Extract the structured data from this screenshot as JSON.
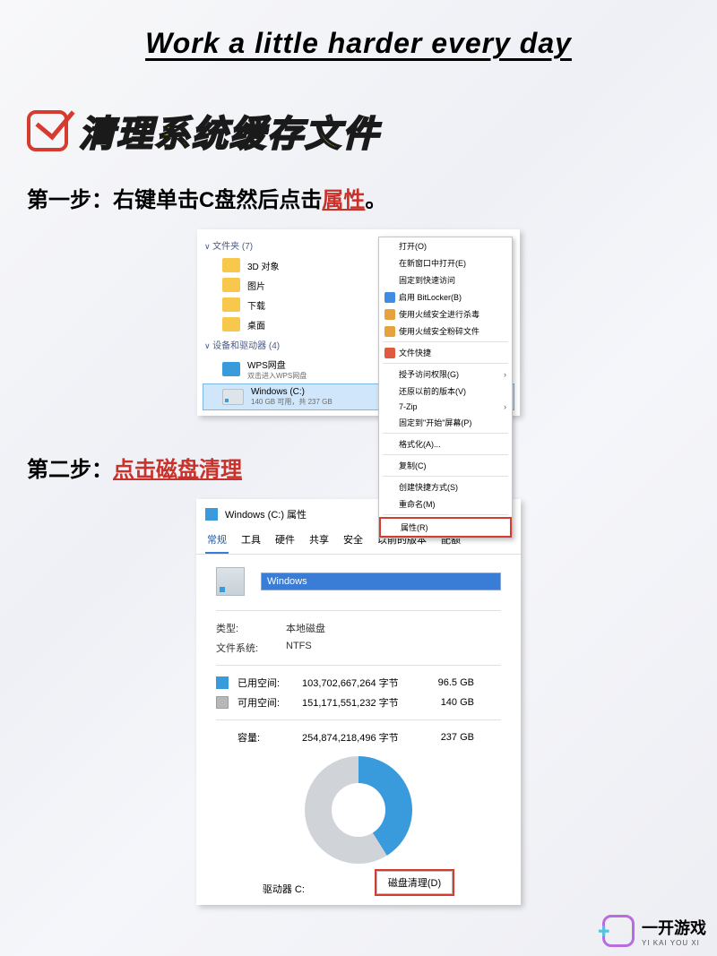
{
  "page": {
    "title": "Work a little harder every day"
  },
  "section": {
    "title": "清理系统缓存文件"
  },
  "step1": {
    "prefix": "第一步：右键单击C盘然后点击",
    "highlight": "属性",
    "suffix": "。"
  },
  "step2": {
    "prefix": "第二步：",
    "highlight": "点击磁盘清理"
  },
  "explorer": {
    "folders_header": "文件夹 (7)",
    "items": {
      "obj3d": "3D 对象",
      "pictures": "图片",
      "downloads": "下载",
      "desktop": "桌面"
    },
    "drives_header": "设备和驱动器 (4)",
    "wps": {
      "name": "WPS网盘",
      "sub": "双击进入WPS网盘"
    },
    "cdrive": {
      "name": "Windows  (C:)",
      "sub": "140 GB 可用，共 237 GB"
    }
  },
  "context_menu": {
    "open": "打开(O)",
    "open_new_window": "在新窗口中打开(E)",
    "pin_quick": "固定到快速访问",
    "bitlocker": "启用 BitLocker(B)",
    "huorong_scan": "使用火绒安全进行杀毒",
    "huorong_shred": "使用火绒安全粉碎文件",
    "file_shred": "文件快捷",
    "grant_access": "授予访问权限(G)",
    "restore_prev": "还原以前的版本(V)",
    "sevenzip": "7-Zip",
    "pin_start": "固定到\"开始\"屏幕(P)",
    "format": "格式化(A)...",
    "copy": "复制(C)",
    "create_shortcut": "创建快捷方式(S)",
    "rename": "重命名(M)",
    "properties": "属性(R)"
  },
  "props": {
    "title": "Windows  (C:) 属性",
    "tabs": {
      "general": "常规",
      "tools": "工具",
      "hardware": "硬件",
      "sharing": "共享",
      "security": "安全",
      "prev_versions": "以前的版本",
      "quota": "配额"
    },
    "name_value": "Windows",
    "type_label": "类型:",
    "type_value": "本地磁盘",
    "fs_label": "文件系统:",
    "fs_value": "NTFS",
    "used_label": "已用空间:",
    "used_bytes": "103,702,667,264 字节",
    "used_gb": "96.5 GB",
    "free_label": "可用空间:",
    "free_bytes": "151,171,551,232 字节",
    "free_gb": "140 GB",
    "cap_label": "容量:",
    "cap_bytes": "254,874,218,496 字节",
    "cap_gb": "237 GB",
    "drive_label": "驱动器 C:",
    "clean_btn": "磁盘清理(D)"
  },
  "brand": {
    "name": "一开游戏",
    "sub": "YI KAI YOU XI"
  }
}
